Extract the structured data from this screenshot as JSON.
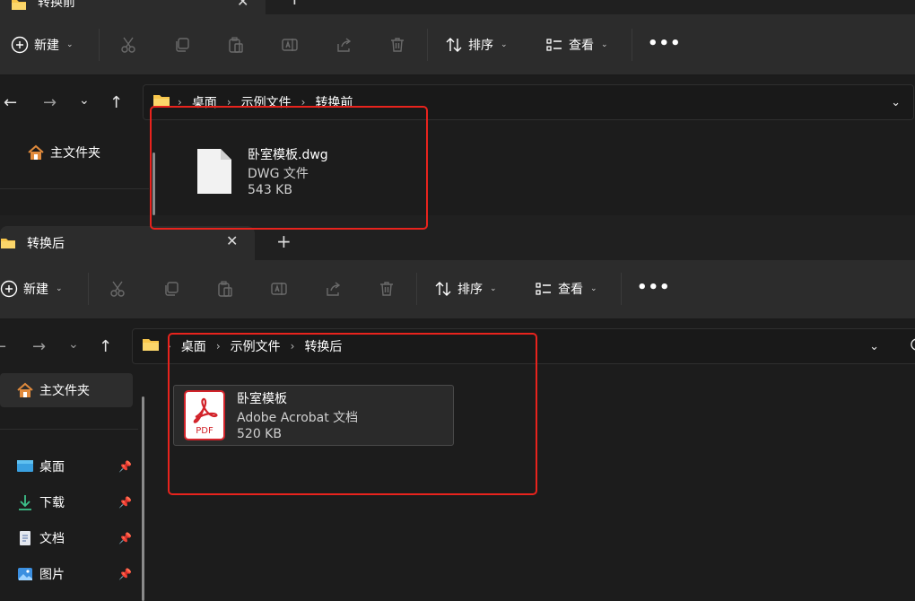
{
  "colors": {
    "accent_red": "#e8231d",
    "bg": "#191919",
    "folder": "#f8c64b",
    "pdf_red": "#d2232a"
  },
  "window_top": {
    "tab_title": "转换前",
    "toolbar": {
      "new_label": "新建",
      "sort_label": "排序",
      "view_label": "查看",
      "more": "•••"
    },
    "breadcrumb": [
      "桌面",
      "示例文件",
      "转换前"
    ],
    "sidebar": {
      "home_label": "主文件夹"
    },
    "file": {
      "name": "卧室模板.dwg",
      "type": "DWG 文件",
      "size": "543 KB",
      "icon": "generic-file-icon"
    }
  },
  "window_bottom": {
    "tab_title": "转换后",
    "new_tab": "+",
    "toolbar": {
      "new_label": "新建",
      "sort_label": "排序",
      "view_label": "查看",
      "more": "•••"
    },
    "breadcrumb": [
      "桌面",
      "示例文件",
      "转换后"
    ],
    "sidebar": {
      "home_label": "主文件夹",
      "pinned": [
        {
          "label": "桌面",
          "icon": "desktop-icon"
        },
        {
          "label": "下载",
          "icon": "download-icon"
        },
        {
          "label": "文档",
          "icon": "document-icon"
        },
        {
          "label": "图片",
          "icon": "pictures-icon"
        }
      ]
    },
    "file": {
      "name": "卧室模板",
      "type": "Adobe Acrobat 文档",
      "size": "520 KB",
      "icon": "pdf-icon",
      "icon_text": "PDF"
    }
  }
}
